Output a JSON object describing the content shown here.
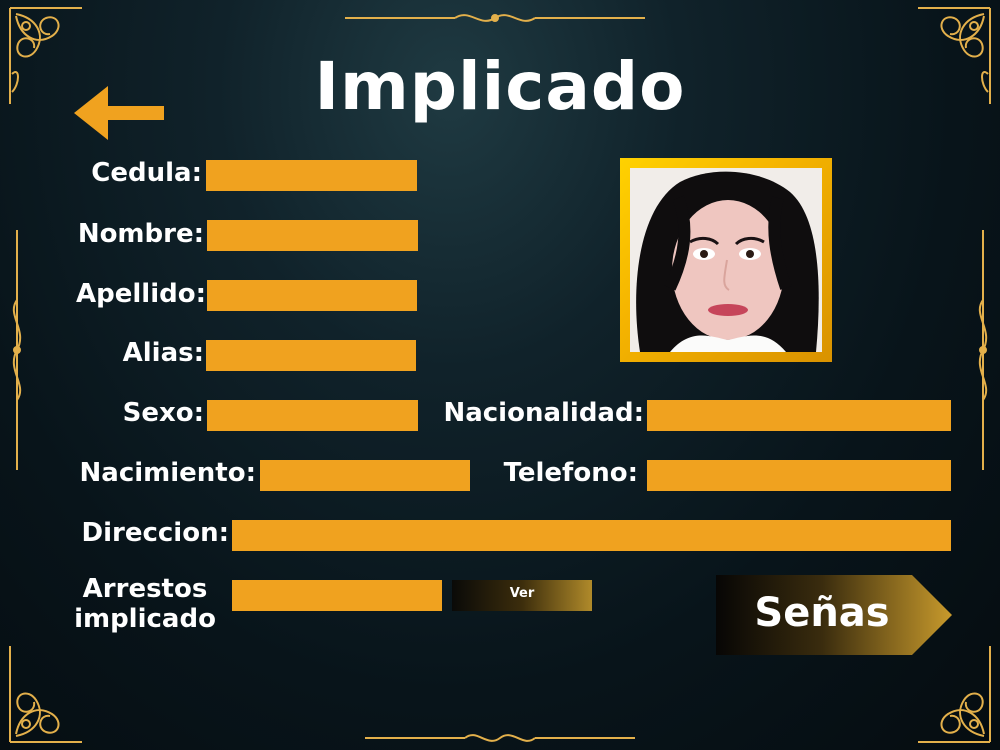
{
  "page": {
    "title": "Implicado"
  },
  "fields": {
    "cedula": {
      "label": "Cedula:",
      "value": ""
    },
    "nombre": {
      "label": "Nombre:",
      "value": ""
    },
    "apellido": {
      "label": "Apellido:",
      "value": ""
    },
    "alias": {
      "label": "Alias:",
      "value": ""
    },
    "sexo": {
      "label": "Sexo:",
      "value": ""
    },
    "nacionalidad": {
      "label": "Nacionalidad:",
      "value": ""
    },
    "nacimiento": {
      "label": "Nacimiento:",
      "value": ""
    },
    "telefono": {
      "label": "Telefono:",
      "value": ""
    },
    "direccion": {
      "label": "Direccion:",
      "value": ""
    },
    "arrestos": {
      "label_line1": "Arrestos",
      "label_line2": "implicado",
      "value": ""
    }
  },
  "buttons": {
    "ver": "Ver",
    "senas": "Señas"
  },
  "colors": {
    "field": "#f0a21f",
    "ornament": "#e3b04b",
    "accent_arrow": "#f0a21f"
  },
  "icons": {
    "back": "left-arrow-icon",
    "photo": "suspect-photo"
  }
}
